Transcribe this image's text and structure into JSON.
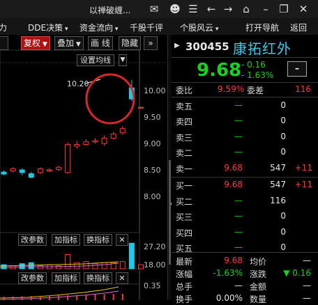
{
  "window": {
    "title": "以禅破缠..."
  },
  "menu": {
    "items": [
      "力",
      "DDE决策",
      "资金流向",
      "千股千评",
      "个股风云",
      "打开导航",
      "返回"
    ]
  },
  "chart_toolbar": {
    "fuquan": "复权",
    "diejia": "叠加",
    "huaxian": "画 线",
    "yincang": "隐藏",
    "more": "»"
  },
  "chart": {
    "set_ma": "设置均线",
    "high_label": "10.20",
    "y_ticks": [
      "10.00",
      "9.50",
      "9.00",
      "8.50",
      "8.00"
    ],
    "volume_tabs": [
      "改参数",
      "加指标",
      "换指标"
    ],
    "volume_tick": "27.20",
    "volume_tick2": "18.00",
    "macd_tabs": [
      "改参数",
      "加指标",
      "换指标"
    ],
    "macd_tick": "0.35",
    "close_icon": "✕"
  },
  "stock": {
    "code": "300455",
    "name": "康拓红外",
    "price": "9.68",
    "change": "- 0.16",
    "change_pct": "- 1.63%",
    "ratio_label": "委比",
    "ratio_value": "9.59%",
    "diff_label": "委差",
    "diff_value": "116"
  },
  "asks": [
    {
      "label": "卖五",
      "price": "—",
      "vol": "0",
      "chg": ""
    },
    {
      "label": "卖四",
      "price": "—",
      "vol": "0",
      "chg": ""
    },
    {
      "label": "卖三",
      "price": "—",
      "vol": "0",
      "chg": ""
    },
    {
      "label": "卖二",
      "price": "—",
      "vol": "0",
      "chg": ""
    },
    {
      "label": "卖一",
      "price": "9.68",
      "vol": "547",
      "chg": "+11"
    }
  ],
  "bids": [
    {
      "label": "买一",
      "price": "9.68",
      "vol": "547",
      "chg": "+11"
    },
    {
      "label": "买二",
      "price": "—",
      "vol": "116",
      "chg": ""
    },
    {
      "label": "买三",
      "price": "—",
      "vol": "0",
      "chg": ""
    },
    {
      "label": "买四",
      "price": "—",
      "vol": "0",
      "chg": ""
    },
    {
      "label": "买五",
      "price": "—",
      "vol": "0",
      "chg": ""
    }
  ],
  "stats": {
    "latest_label": "最新",
    "latest": "9.68",
    "avg_label": "均价",
    "avg": "—",
    "zf_label": "涨幅",
    "zf": "-1.63%",
    "zd_label": "涨跌",
    "zd": "▼ 0.16",
    "zs_label": "总手",
    "zs": "—",
    "je_label": "金额",
    "je": "—",
    "hs_label": "换手",
    "hs": "0.00%",
    "sl_label": "数量",
    "sl": "—"
  },
  "colors": {
    "up": "#ff3b3b",
    "down": "#19d11f",
    "accent": "#3cc8e8"
  },
  "candles": [
    {
      "o": 8.46,
      "c": 8.42,
      "h": 8.49,
      "l": 8.4
    },
    {
      "o": 8.48,
      "c": 8.52,
      "h": 8.55,
      "l": 8.45
    },
    {
      "o": 8.5,
      "c": 8.45,
      "h": 8.53,
      "l": 8.4
    },
    {
      "o": 8.43,
      "c": 8.36,
      "h": 8.46,
      "l": 8.34
    },
    {
      "o": 8.45,
      "c": 8.52,
      "h": 8.55,
      "l": 8.42
    },
    {
      "o": 8.48,
      "c": 8.5,
      "h": 8.53,
      "l": 8.46
    },
    {
      "o": 8.51,
      "c": 8.55,
      "h": 8.58,
      "l": 8.48
    },
    {
      "o": 8.45,
      "c": 8.98,
      "h": 9.02,
      "l": 8.43
    },
    {
      "o": 8.95,
      "c": 8.98,
      "h": 9.05,
      "l": 8.9
    },
    {
      "o": 8.98,
      "c": 9.03,
      "h": 9.08,
      "l": 8.96
    },
    {
      "o": 9.03,
      "c": 9.05,
      "h": 9.1,
      "l": 9.0
    },
    {
      "o": 9.0,
      "c": 9.1,
      "h": 9.15,
      "l": 8.96
    },
    {
      "o": 9.1,
      "c": 9.18,
      "h": 9.22,
      "l": 9.07
    },
    {
      "o": 9.2,
      "c": 9.28,
      "h": 9.33,
      "l": 9.16
    },
    {
      "o": 10.05,
      "c": 9.84,
      "h": 10.2,
      "l": 9.8
    },
    {
      "o": 9.68,
      "c": 9.68,
      "h": 9.7,
      "l": 9.66
    }
  ],
  "volumes": [
    4,
    3,
    5,
    6,
    3,
    4,
    3,
    14,
    6,
    7,
    5,
    6,
    6,
    7,
    25,
    4
  ]
}
